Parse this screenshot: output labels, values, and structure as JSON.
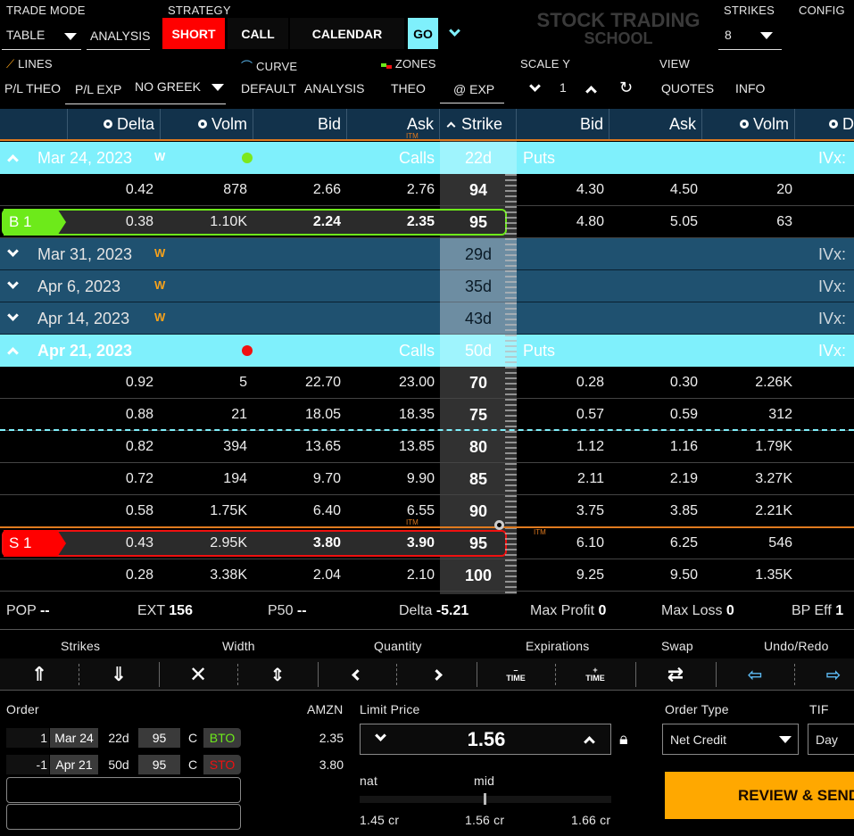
{
  "toolbar": {
    "trade_mode_label": "TRADE MODE",
    "trade_mode_value": "TABLE",
    "analysis_label": "ANALYSIS",
    "strategy_label": "STRATEGY",
    "strategy_side": "SHORT",
    "strategy_type": "CALL",
    "strategy_name": "CALENDAR",
    "go_label": "GO",
    "logo_line1": "STOCK TRADING",
    "logo_line2": "SCHOOL",
    "strikes_label": "STRIKES",
    "strikes_value": "8",
    "config_label": "CONFIG",
    "lines_label": "LINES",
    "curve_label": "CURVE",
    "zones_label": "ZONES",
    "scale_y_label": "SCALE Y",
    "view_label": "VIEW",
    "pl_theo": "P/L THEO",
    "pl_exp": "P/L EXP",
    "no_greek": "NO GREEK",
    "default": "DEFAULT",
    "analysis2": "ANALYSIS",
    "theo": "THEO",
    "at_exp": "@ EXP",
    "scale_value": "1",
    "quotes": "QUOTES",
    "info": "INFO"
  },
  "table": {
    "headers": {
      "delta": "Delta",
      "volm": "Volm",
      "bid": "Bid",
      "ask": "Ask",
      "strike": "Strike",
      "put_bid": "Bid",
      "put_ask": "Ask",
      "put_volm": "Volm",
      "put_delta": "D"
    },
    "itm_label": "ITM",
    "calls_label": "Calls",
    "puts_label": "Puts",
    "ivx_label": "IVx:",
    "expirations": [
      {
        "date": "Mar 24, 2023",
        "weekly": "W",
        "dte": "22d",
        "open": true,
        "dot_color": "#7de81c",
        "rows": [
          {
            "delta": "0.42",
            "volm": "878",
            "bid": "2.66",
            "ask": "2.76",
            "strike": "94",
            "pbid": "4.30",
            "pask": "4.50",
            "pvolm": "20"
          },
          {
            "delta": "0.38",
            "volm": "1.10K",
            "bid": "2.24",
            "ask": "2.35",
            "strike": "95",
            "pbid": "4.80",
            "pask": "5.05",
            "pvolm": "63",
            "leg": "B 1"
          }
        ]
      },
      {
        "date": "Mar 31, 2023",
        "weekly": "W",
        "dte": "29d",
        "open": false
      },
      {
        "date": "Apr 6, 2023",
        "weekly": "W",
        "dte": "35d",
        "open": false
      },
      {
        "date": "Apr 14, 2023",
        "weekly": "W",
        "dte": "43d",
        "open": false
      },
      {
        "date": "Apr 21, 2023",
        "weekly": "",
        "dte": "50d",
        "open": true,
        "dot_color": "#f01010",
        "rows": [
          {
            "delta": "0.92",
            "volm": "5",
            "bid": "22.70",
            "ask": "23.00",
            "strike": "70",
            "pbid": "0.28",
            "pask": "0.30",
            "pvolm": "2.26K"
          },
          {
            "delta": "0.88",
            "volm": "21",
            "bid": "18.05",
            "ask": "18.35",
            "strike": "75",
            "pbid": "0.57",
            "pask": "0.59",
            "pvolm": "312"
          },
          {
            "delta": "0.82",
            "volm": "394",
            "bid": "13.65",
            "ask": "13.85",
            "strike": "80",
            "pbid": "1.12",
            "pask": "1.16",
            "pvolm": "1.79K"
          },
          {
            "delta": "0.72",
            "volm": "194",
            "bid": "9.70",
            "ask": "9.90",
            "strike": "85",
            "pbid": "2.11",
            "pask": "2.19",
            "pvolm": "3.27K"
          },
          {
            "delta": "0.58",
            "volm": "1.75K",
            "bid": "6.40",
            "ask": "6.55",
            "strike": "90",
            "pbid": "3.75",
            "pask": "3.85",
            "pvolm": "2.21K"
          },
          {
            "delta": "0.43",
            "volm": "2.95K",
            "bid": "3.80",
            "ask": "3.90",
            "strike": "95",
            "pbid": "6.10",
            "pask": "6.25",
            "pvolm": "546",
            "leg": "S 1"
          },
          {
            "delta": "0.28",
            "volm": "3.38K",
            "bid": "2.04",
            "ask": "2.10",
            "strike": "100",
            "pbid": "9.25",
            "pask": "9.50",
            "pvolm": "1.35K"
          }
        ]
      }
    ]
  },
  "stats": {
    "pop_label": "POP",
    "pop": "--",
    "ext_label": "EXT",
    "ext": "156",
    "p50_label": "P50",
    "p50": "--",
    "delta_label": "Delta",
    "delta": "-5.21",
    "max_profit_label": "Max Profit",
    "max_profit": "0",
    "max_loss_label": "Max Loss",
    "max_loss": "0",
    "bp_eff_label": "BP Eff",
    "bp_eff": "1"
  },
  "controls": {
    "strikes": "Strikes",
    "width": "Width",
    "quantity": "Quantity",
    "expirations": "Expirations",
    "swap": "Swap",
    "undo_redo": "Undo/Redo",
    "time_label": "TIME"
  },
  "order": {
    "label": "Order",
    "symbol": "AMZN",
    "legs": [
      {
        "qty": "1",
        "exp": "Mar 24",
        "dte": "22d",
        "strike": "95",
        "type": "C",
        "action": "BTO",
        "price": "2.35",
        "action_color": "#6dea1a"
      },
      {
        "qty": "-1",
        "exp": "Apr 21",
        "dte": "50d",
        "strike": "95",
        "type": "C",
        "action": "STO",
        "price": "3.80",
        "action_color": "#f01010"
      }
    ],
    "limit_label": "Limit Price",
    "limit_value": "1.56",
    "nat_label": "nat",
    "mid_label": "mid",
    "nat_price": "1.45 cr",
    "mid_price": "1.56 cr",
    "far_price": "1.66 cr",
    "order_type_label": "Order Type",
    "order_type": "Net Credit",
    "tif_label": "TIF",
    "tif": "Day",
    "review_label": "REVIEW & SEND"
  },
  "colors": {
    "accent_cyan": "#7ff0fc",
    "short_red": "#ff0000",
    "review_orange": "#ffa800",
    "expiry_blue": "#1f5170"
  }
}
